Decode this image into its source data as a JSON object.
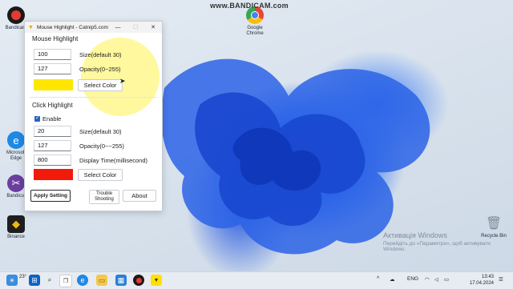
{
  "watermark": "www.BANDICAM.com",
  "activation": {
    "line1": "Активація Windows",
    "line2": "Перейдіть до «Параметри», щоб активувати Windows."
  },
  "desktop_icons": [
    {
      "label": "Bandicam",
      "icon": "record-icon",
      "color": "#d32f2f"
    },
    {
      "label": "Microsoft Edge",
      "icon": "edge-icon",
      "color": "#1e88e5"
    },
    {
      "label": "Bandicut",
      "icon": "bandicut-icon",
      "color": "#8e44ad"
    },
    {
      "label": "Binance",
      "icon": "binance-icon",
      "color": "#f0b90b"
    },
    {
      "label": "Google Chrome",
      "icon": "chrome-icon",
      "color": "#34a853"
    },
    {
      "label": "Recycle Bin",
      "icon": "recycle-bin-icon",
      "color": "#9aa7b4"
    }
  ],
  "window": {
    "title": "Mouse Highlight - Catnip5.com",
    "controls": {
      "minimize": "—",
      "maximize": "☐",
      "close": "✕"
    },
    "mouse_highlight": {
      "heading": "Mouse Highlight",
      "size_value": "100",
      "size_label": "Size(default 30)",
      "opacity_value": "127",
      "opacity_label": "Opacity(0~255)",
      "color": "#ffe600",
      "select_color": "Select Color"
    },
    "click_highlight": {
      "heading": "Click Highlight",
      "enable_label": "Enable",
      "enabled": true,
      "size_value": "20",
      "size_label": "Size(default 30)",
      "opacity_value": "127",
      "opacity_label": "Opacity(0~~255)",
      "display_time_value": "800",
      "display_time_label": "Display Time(millisecond)",
      "color": "#f21a0a",
      "select_color": "Select Color"
    },
    "buttons": {
      "apply": "Apply Setting",
      "trouble_line1": "Trouble",
      "trouble_line2": "Shooting",
      "about": "About"
    }
  },
  "taskbar": {
    "weather": "23°",
    "language": "ENG",
    "time": "13:43",
    "date": "17.04.2024"
  }
}
